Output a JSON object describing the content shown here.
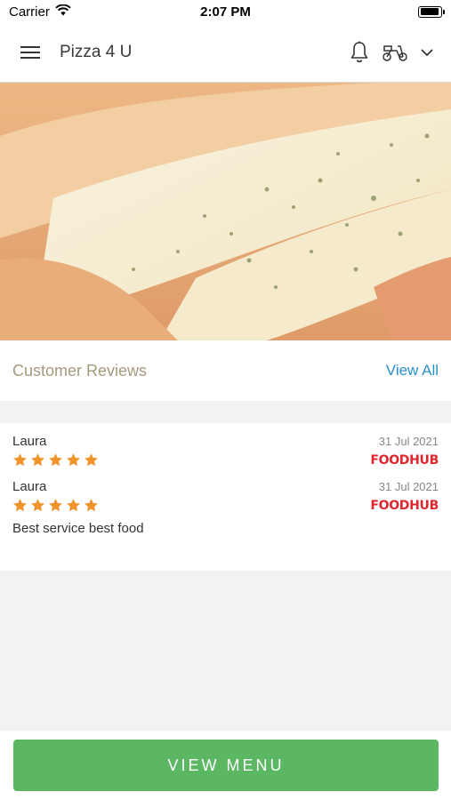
{
  "status_bar": {
    "carrier": "Carrier",
    "time": "2:07 PM",
    "battery_level": 0.95
  },
  "header": {
    "title": "Pizza 4 U",
    "icons": [
      "menu-icon",
      "bell-icon",
      "scooter-icon",
      "chevron-down-icon"
    ]
  },
  "hero": {
    "image": "pizza-photo"
  },
  "reviews": {
    "title": "Customer Reviews",
    "view_all_label": "View All",
    "items": [
      {
        "name": "Laura",
        "date": "31 Jul 2021",
        "rating": 5,
        "source": "FOODHUB",
        "text": ""
      },
      {
        "name": "Laura",
        "date": "31 Jul 2021",
        "rating": 5,
        "source": "FOODHUB",
        "text": "Best service best food"
      }
    ]
  },
  "footer": {
    "button_label": "VIEW MENU"
  },
  "colors": {
    "accent": "#5cb763",
    "link": "#2a8fc8",
    "star": "#f0932b",
    "brand": "#e0262e"
  }
}
